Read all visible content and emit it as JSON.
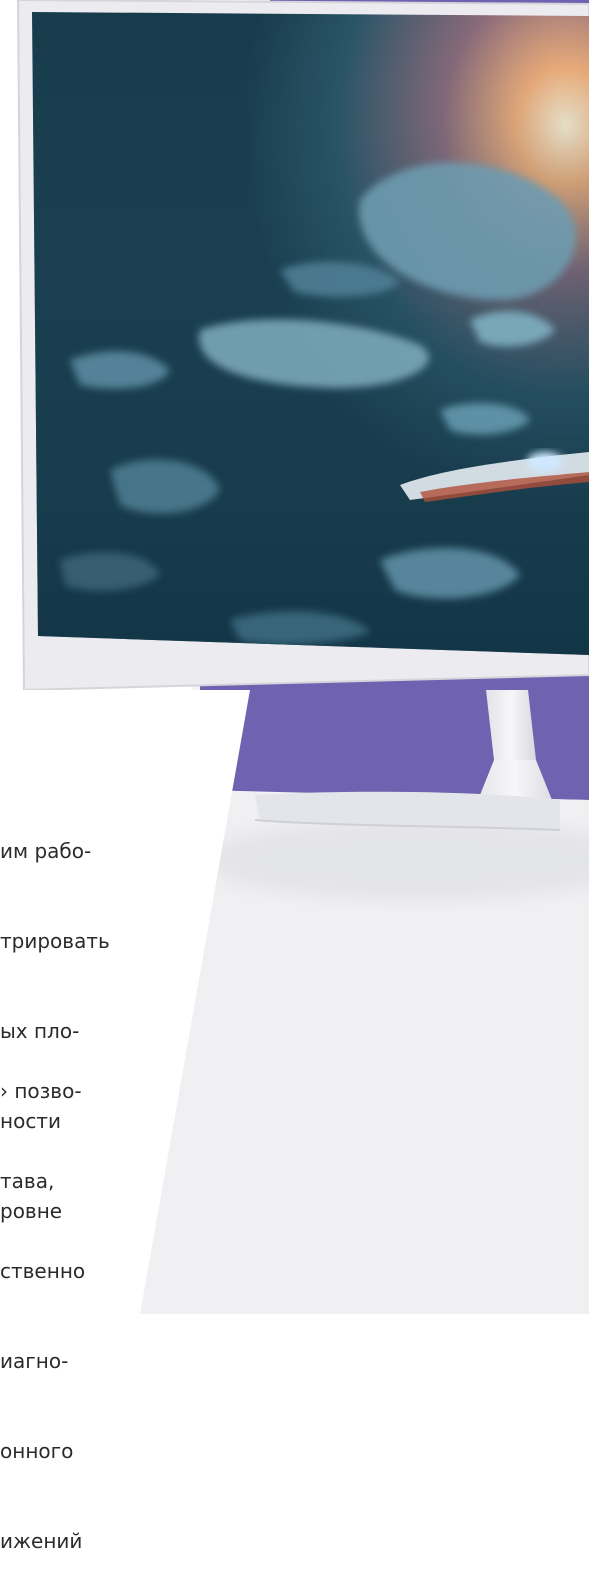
{
  "paragraph_1": {
    "lines": [
      "им рабо-",
      "трировать",
      "ых пло-",
      "ности",
      "ровне"
    ]
  },
  "paragraph_2": {
    "lines": [
      "› позво-",
      "тава,",
      "ственно",
      "иагно-",
      "онного",
      "ижений"
    ]
  },
  "colors": {
    "accent_purple": "#6f62b0",
    "monitor_bezel": "#eaeaee",
    "screen_space": "#1d4a5c",
    "sun_glow": "#ffd7a0",
    "desk_white": "#f2f2f4"
  },
  "image": {
    "subject": "white-monitor-icon",
    "screen_scene": "space-game-asteroids"
  }
}
